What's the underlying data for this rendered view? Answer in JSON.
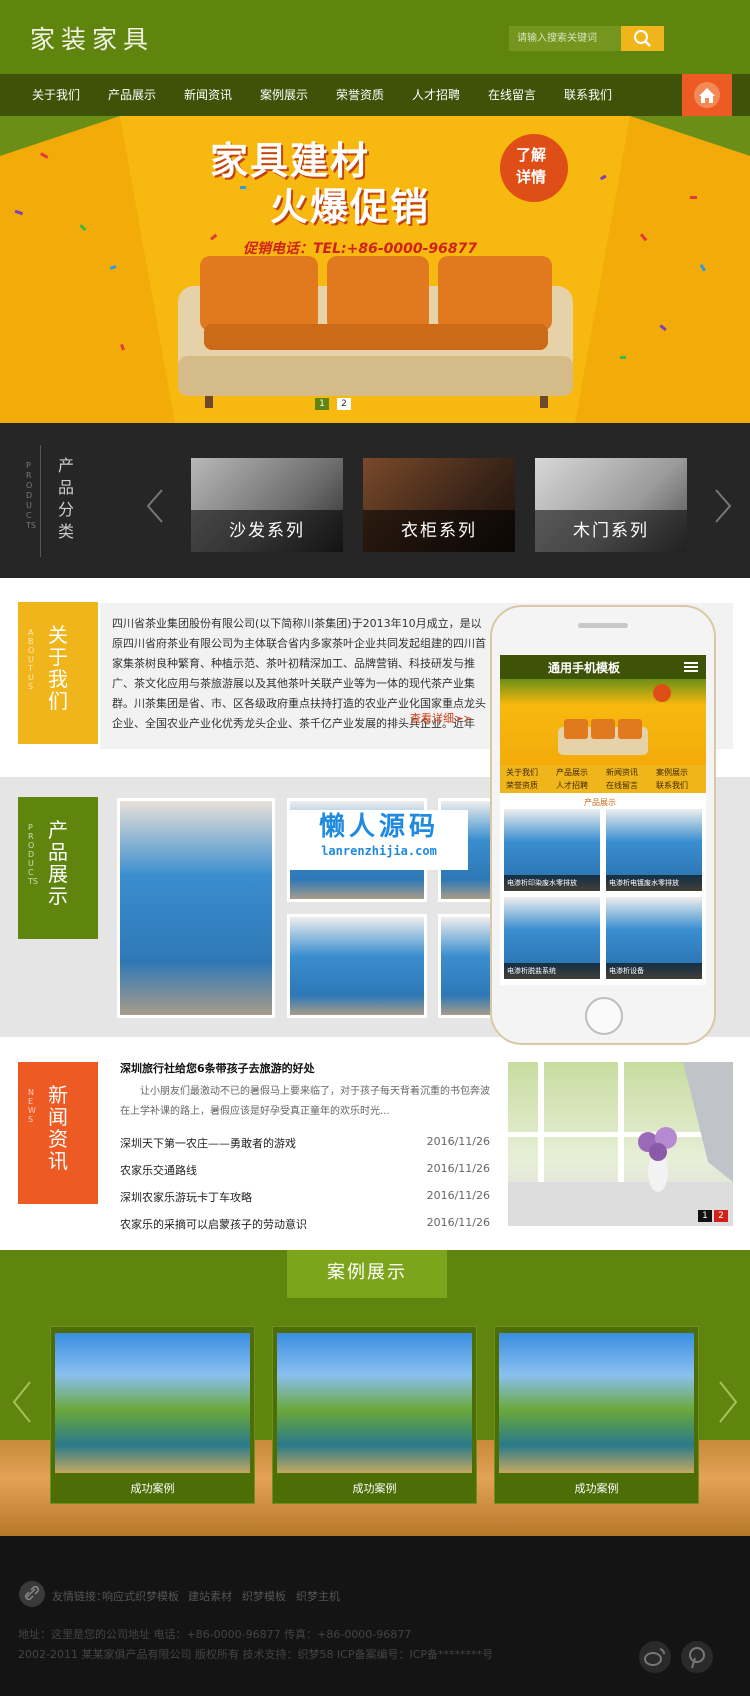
{
  "header": {
    "logo": "家装家具",
    "search_placeholder": "请输入搜索关键词"
  },
  "nav": {
    "items": [
      "关于我们",
      "产品展示",
      "新闻资讯",
      "案例展示",
      "荣誉资质",
      "人才招聘",
      "在线留言",
      "联系我们"
    ]
  },
  "banner": {
    "headline_1": "家具建材",
    "headline_2": "火爆促销",
    "badge_1": "了解",
    "badge_2": "详情",
    "phone": "促销电话：TEL:+86-0000-96877",
    "slides": [
      "1",
      "2"
    ]
  },
  "categories": {
    "title": "产品分类",
    "title_en": "PRODUCTS",
    "items": [
      "沙发系列",
      "衣柜系列",
      "木门系列"
    ]
  },
  "about": {
    "title": "关于我们",
    "title_en": "ABOUT US",
    "text": "四川省茶业集团股份有限公司(以下简称川茶集团)于2013年10月成立，是以原四川省府茶业有限公司为主体联合省内多家茶叶企业共同发起组建的四川首家集茶树良种繁育、种植示范、茶叶初精深加工、品牌营销、科技研发与推广、茶文化应用与茶旅游展以及其他茶叶关联产业等为一体的现代茶产业集群。川茶集团是省、市、区各级政府重点扶持打造的农业产业化国家重点龙头企业、全国农业产业化优秀龙头企业、茶千亿产业发展的排头兵企业。近年来，集团在翠屏区屏场、",
    "more": "查看详细>>"
  },
  "products": {
    "title": "产品展示",
    "title_en": "PRODUCTS"
  },
  "watermark": {
    "title": "懒人源码",
    "url": "lanrenzhijia.com"
  },
  "news": {
    "title": "新闻资讯",
    "title_en": "NEWS",
    "headline": "深圳旅行社给您6条带孩子去旅游的好处",
    "summary": "让小朋友们最激动不已的暑假马上要来临了，对于孩子每天背着沉重的书包奔波在上学补课的路上，暑假应该是好孕受真正童年的欢乐时光...",
    "items": [
      {
        "title": "深圳天下第一农庄——勇敢者的游戏",
        "date": "2016/11/26"
      },
      {
        "title": "农家乐交通路线",
        "date": "2016/11/26"
      },
      {
        "title": "深圳农家乐游玩卡丁车攻略",
        "date": "2016/11/26"
      },
      {
        "title": "农家乐的采摘可以启蒙孩子的劳动意识",
        "date": "2016/11/26"
      }
    ],
    "slides": [
      "1",
      "2"
    ]
  },
  "cases": {
    "title": "案例展示",
    "items": [
      "成功案例",
      "成功案例",
      "成功案例"
    ]
  },
  "phone": {
    "title": "通用手机模板",
    "nav": [
      "关于我们",
      "产品展示",
      "新闻资讯",
      "案例展示",
      "荣誉资质",
      "人才招聘",
      "在线留言",
      "联系我们"
    ],
    "section": "产品展示",
    "products": [
      "电渗析印染废水零排放",
      "电渗析电镀废水零排放",
      "电渗析脱盐系统",
      "电渗析设备"
    ]
  },
  "footer": {
    "links_label": "友情链接：",
    "links": [
      "响应式织梦模板",
      "建站素材",
      "织梦模板",
      "织梦主机"
    ],
    "address": "地址：这里是您的公司地址    电话：+86-0000-96877    传真：+86-0000-96877",
    "copyright": "2002-2011 某某家俱产品有限公司 版权所有    技术支持：织梦58    ICP备案编号：ICP备********号"
  },
  "colors": {
    "brand_green": "#5f850f",
    "dark_green": "#3e5307",
    "accent_yellow": "#f1b51c",
    "accent_orange": "#ee5a23"
  }
}
